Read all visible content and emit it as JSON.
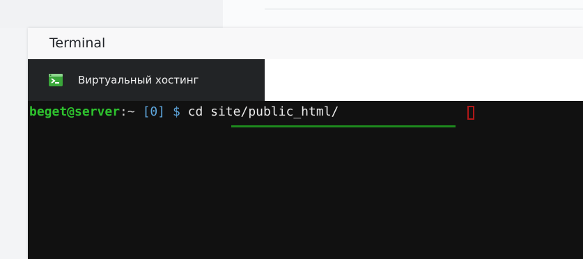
{
  "window": {
    "title": "Terminal"
  },
  "tab": {
    "label": "Виртуальный хостинг",
    "icon": "terminal-icon"
  },
  "terminal": {
    "user_host": "beget@server",
    "colon": ":",
    "path": "~",
    "space1": " ",
    "exit_code": "[0]",
    "space2": " ",
    "prompt_symbol": "$",
    "space3": " ",
    "command": "cd site/public_html/"
  },
  "colors": {
    "user_host": "#2ec22e",
    "prompt_symbol": "#5ea7de",
    "cursor": "#b01818",
    "terminal_bg": "#111111"
  }
}
